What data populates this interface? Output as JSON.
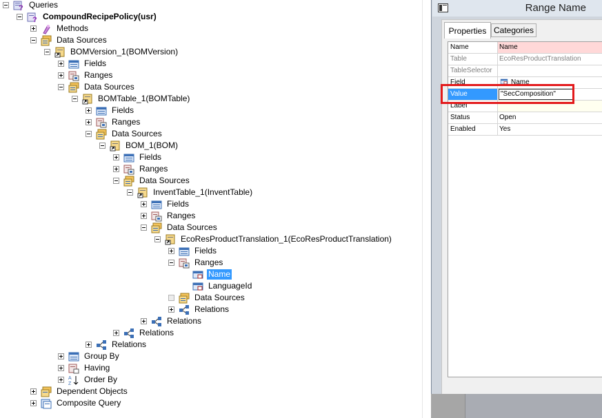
{
  "tree": {
    "items": [
      {
        "label": "Queries",
        "expander": "minus",
        "icon": "queries-icon",
        "bold": false,
        "selected": false
      },
      {
        "label": "CompoundRecipePolicy(usr)",
        "expander": "minus",
        "icon": "query-icon",
        "bold": true,
        "selected": false
      },
      {
        "label": "Methods",
        "expander": "plus",
        "icon": "methods-icon",
        "bold": false,
        "selected": false
      },
      {
        "label": "Data Sources",
        "expander": "minus",
        "icon": "datasources-icon",
        "bold": false,
        "selected": false
      },
      {
        "label": "BOMVersion_1(BOMVersion)",
        "expander": "minus",
        "icon": "datasource-icon",
        "bold": false,
        "selected": false
      },
      {
        "label": "Fields",
        "expander": "plus",
        "icon": "fields-icon",
        "bold": false,
        "selected": false
      },
      {
        "label": "Ranges",
        "expander": "plus",
        "icon": "ranges-icon",
        "bold": false,
        "selected": false
      },
      {
        "label": "Data Sources",
        "expander": "minus",
        "icon": "datasources-icon",
        "bold": false,
        "selected": false
      },
      {
        "label": "BOMTable_1(BOMTable)",
        "expander": "minus",
        "icon": "datasource-icon",
        "bold": false,
        "selected": false
      },
      {
        "label": "Fields",
        "expander": "plus",
        "icon": "fields-icon",
        "bold": false,
        "selected": false
      },
      {
        "label": "Ranges",
        "expander": "plus",
        "icon": "ranges-icon",
        "bold": false,
        "selected": false
      },
      {
        "label": "Data Sources",
        "expander": "minus",
        "icon": "datasources-icon",
        "bold": false,
        "selected": false
      },
      {
        "label": "BOM_1(BOM)",
        "expander": "minus",
        "icon": "datasource-icon",
        "bold": false,
        "selected": false
      },
      {
        "label": "Fields",
        "expander": "plus",
        "icon": "fields-icon",
        "bold": false,
        "selected": false
      },
      {
        "label": "Ranges",
        "expander": "plus",
        "icon": "ranges-icon",
        "bold": false,
        "selected": false
      },
      {
        "label": "Data Sources",
        "expander": "minus",
        "icon": "datasources-icon",
        "bold": false,
        "selected": false
      },
      {
        "label": "InventTable_1(InventTable)",
        "expander": "minus",
        "icon": "datasource-icon",
        "bold": false,
        "selected": false
      },
      {
        "label": "Fields",
        "expander": "plus",
        "icon": "fields-icon",
        "bold": false,
        "selected": false
      },
      {
        "label": "Ranges",
        "expander": "plus",
        "icon": "ranges-icon",
        "bold": false,
        "selected": false
      },
      {
        "label": "Data Sources",
        "expander": "minus",
        "icon": "datasources-icon",
        "bold": false,
        "selected": false
      },
      {
        "label": "EcoResProductTranslation_1(EcoResProductTranslation)",
        "expander": "minus",
        "icon": "datasource-icon",
        "bold": false,
        "selected": false
      },
      {
        "label": "Fields",
        "expander": "plus",
        "icon": "fields-icon",
        "bold": false,
        "selected": false
      },
      {
        "label": "Ranges",
        "expander": "minus",
        "icon": "ranges-icon",
        "bold": false,
        "selected": false
      },
      {
        "label": "Name",
        "expander": "none",
        "icon": "range-icon",
        "bold": false,
        "selected": true
      },
      {
        "label": "LanguageId",
        "expander": "none",
        "icon": "range-icon",
        "bold": false,
        "selected": false
      },
      {
        "label": "Data Sources",
        "expander": "empty",
        "icon": "datasources-icon",
        "bold": false,
        "selected": false
      },
      {
        "label": "Relations",
        "expander": "plus",
        "icon": "relations-icon",
        "bold": false,
        "selected": false
      },
      {
        "label": "Relations",
        "expander": "plus",
        "icon": "relations-icon",
        "bold": false,
        "selected": false
      },
      {
        "label": "Relations",
        "expander": "plus",
        "icon": "relations-icon",
        "bold": false,
        "selected": false
      },
      {
        "label": "Relations",
        "expander": "plus",
        "icon": "relations-icon",
        "bold": false,
        "selected": false
      },
      {
        "label": "Group By",
        "expander": "plus",
        "icon": "groupby-icon",
        "bold": false,
        "selected": false
      },
      {
        "label": "Having",
        "expander": "plus",
        "icon": "having-icon",
        "bold": false,
        "selected": false
      },
      {
        "label": "Order By",
        "expander": "plus",
        "icon": "orderby-icon",
        "bold": false,
        "selected": false
      },
      {
        "label": "Dependent Objects",
        "expander": "plus",
        "icon": "dependent-objects-icon",
        "bold": false,
        "selected": false
      },
      {
        "label": "Composite Query",
        "expander": "plus",
        "icon": "composite-query-icon",
        "bold": false,
        "selected": false
      }
    ]
  },
  "property_window": {
    "title": "Range Name",
    "tabs": [
      {
        "label": "Properties",
        "active": true
      },
      {
        "label": "Categories",
        "active": false
      }
    ],
    "rows": [
      {
        "name": "Name",
        "value": "Name",
        "style": "pink"
      },
      {
        "name": "Table",
        "value": "EcoResProductTranslation",
        "style": "gray"
      },
      {
        "name": "TableSelector",
        "value": "",
        "style": "gray"
      },
      {
        "name": "Field",
        "value": "Name",
        "style": "field"
      },
      {
        "name": "Value",
        "value": "\"SecComposition\"",
        "style": "editing"
      },
      {
        "name": "Label",
        "value": "",
        "style": "yellowish"
      },
      {
        "name": "Status",
        "value": "Open",
        "style": "normal"
      },
      {
        "name": "Enabled",
        "value": "Yes",
        "style": "normal"
      }
    ],
    "highlight_color": "#e3191b",
    "selection_color": "#3399ff"
  }
}
